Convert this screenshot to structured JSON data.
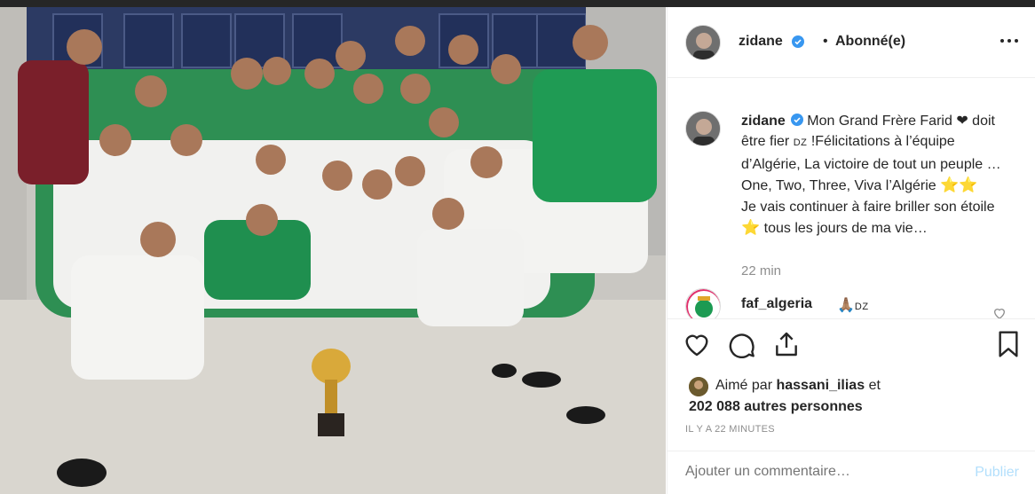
{
  "post": {
    "header": {
      "username": "zidane",
      "separator": "•",
      "follow_label": "Abonné(e)",
      "more_icon": "more-options-icon"
    },
    "caption": {
      "username": "zidane",
      "part1": "Mon Grand Frère Farid",
      "heart": "❤",
      "part2": "doit être fier",
      "flag": "DZ",
      "part3": "!Félicitations à l’équipe d’Algérie, La victoire de tout un peuple … One, Two, Three, Viva l’Algérie",
      "stars1": "⭐⭐",
      "part4": "Je vais continuer à faire briller son étoile",
      "star2": "⭐",
      "part5": "tous les jours de ma vie…",
      "time": "22 min"
    },
    "comment": {
      "username": "faf_algeria",
      "emoji": "🙏🏽",
      "text": "DZ"
    },
    "likes": {
      "prefix": "Aimé par",
      "user": "hassani_ilias",
      "conj": "et",
      "others": "202 088 autres personnes"
    },
    "posted_ago": "IL Y A 22 MINUTES",
    "add_comment": {
      "placeholder": "Ajouter un commentaire…",
      "submit_label": "Publier"
    },
    "colors": {
      "verified": "#3897f0",
      "text": "#262626",
      "muted": "#8e8e8e",
      "publish_disabled": "#b2dffc"
    },
    "icons": [
      "heart-icon",
      "comment-icon",
      "share-icon",
      "bookmark-icon"
    ]
  }
}
